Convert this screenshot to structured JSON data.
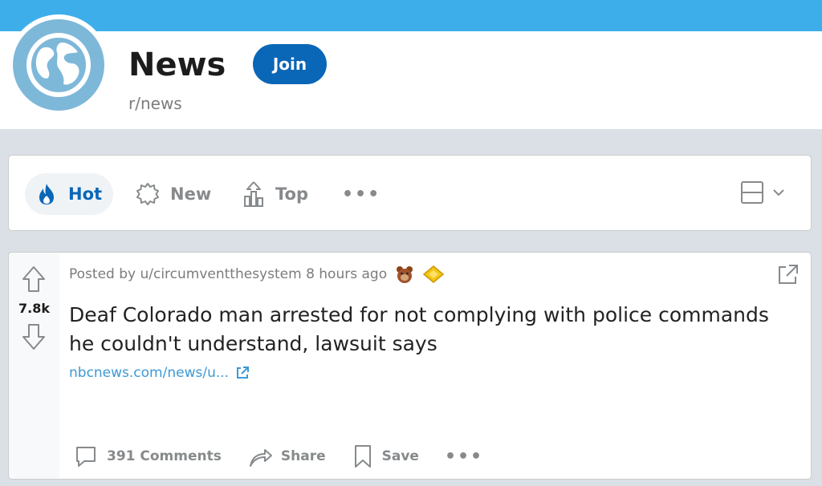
{
  "subreddit": {
    "title": "News",
    "name": "r/news",
    "join_label": "Join",
    "colors": {
      "banner": "#3daeea",
      "avatar": "#7eb8d9",
      "join": "#0a66b7"
    }
  },
  "sort": {
    "items": [
      {
        "label": "Hot",
        "icon": "flame-icon",
        "active": true
      },
      {
        "label": "New",
        "icon": "burst-icon"
      },
      {
        "label": "Top",
        "icon": "chart-up-icon"
      }
    ],
    "more": "•••"
  },
  "post": {
    "votes": "7.8k",
    "meta": "Posted by u/circumventthesystem 8 hours ago",
    "title": "Deaf Colorado man arrested for not complying with police commands he couldn't understand, lawsuit says",
    "link": "nbcnews.com/news/u...",
    "actions": {
      "comments": "391 Comments",
      "share": "Share",
      "save": "Save",
      "more": "•••"
    }
  }
}
